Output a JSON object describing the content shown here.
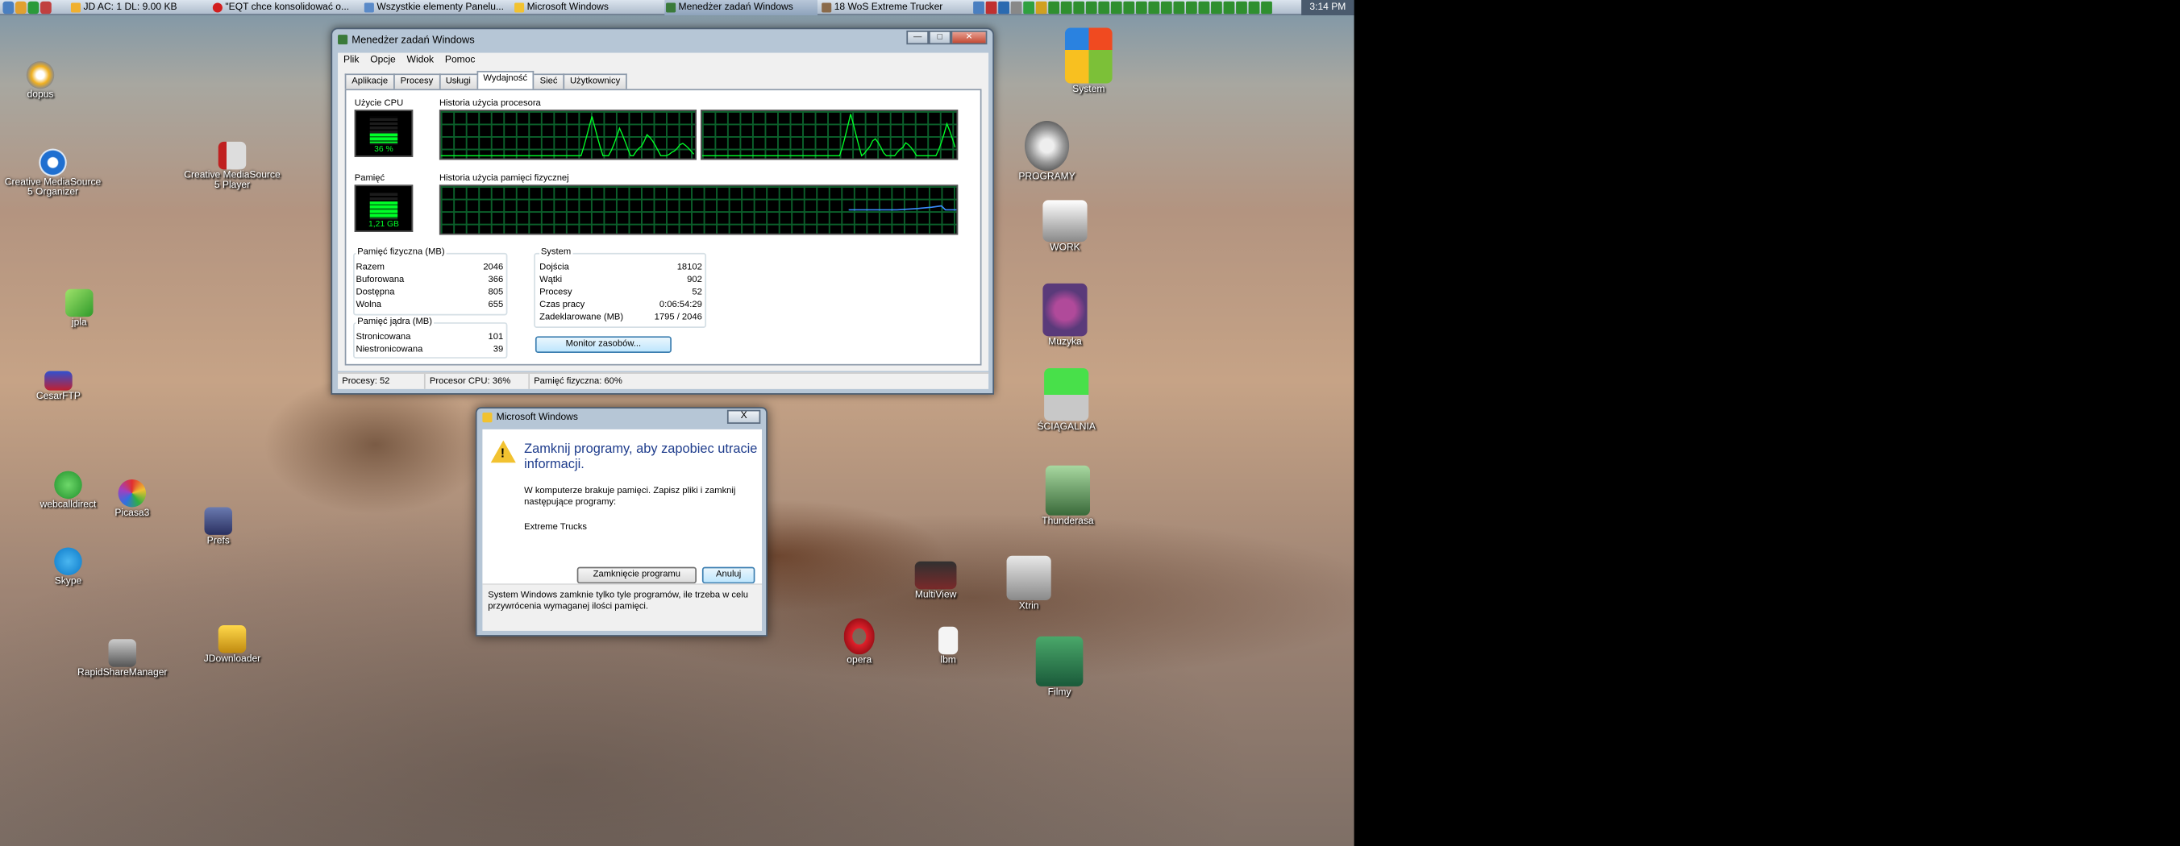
{
  "taskbar": {
    "buttons": [
      {
        "label": "JD AC: 1 DL: 9.00 KB",
        "active": false
      },
      {
        "label": "\"EQT chce konsolidować o...",
        "active": false
      },
      {
        "label": "Wszystkie elementy Panelu...",
        "active": false
      },
      {
        "label": "Microsoft Windows",
        "active": false
      },
      {
        "label": "Menedżer zadań Windows",
        "active": true
      },
      {
        "label": "18 WoS Extreme Trucker",
        "active": false
      }
    ],
    "clock": "3:14 PM"
  },
  "desktop_icons": [
    "dopus",
    "Creative MediaSource 5 Organizer",
    "Creative MediaSource 5 Player",
    "jpla",
    "CesarFTP",
    "webcalldirect",
    "Picasa3",
    "Prefs",
    "Skype",
    "RapidShareManager",
    "JDownloader",
    "System",
    "PROGRAMY",
    "WORK",
    "Muzyka",
    "ŚCIĄGALNIA",
    "Thunderasa",
    "MultiView",
    "Xtrin",
    "opera",
    "lbm",
    "Filmy"
  ],
  "task_manager": {
    "title": "Menedżer zadań Windows",
    "menu": [
      "Plik",
      "Opcje",
      "Widok",
      "Pomoc"
    ],
    "tabs": [
      "Aplikacje",
      "Procesy",
      "Usługi",
      "Wydajność",
      "Sieć",
      "Użytkownicy"
    ],
    "selected_tab": "Wydajność",
    "cpu": {
      "label": "Użycie CPU",
      "value": "36 %",
      "fraction": 0.36,
      "history_label": "Historia użycia procesora"
    },
    "memory": {
      "label": "Pamięć",
      "value": "1,21 GB",
      "fraction": 0.6,
      "history_label": "Historia użycia pamięci fizycznej"
    },
    "physical": {
      "title": "Pamięć fizyczna (MB)",
      "rows": [
        [
          "Razem",
          "2046"
        ],
        [
          "Buforowana",
          "366"
        ],
        [
          "Dostępna",
          "805"
        ],
        [
          "Wolna",
          "655"
        ]
      ]
    },
    "kernel": {
      "title": "Pamięć jądra (MB)",
      "rows": [
        [
          "Stronicowana",
          "101"
        ],
        [
          "Niestronicowana",
          "39"
        ]
      ]
    },
    "system": {
      "title": "System",
      "rows": [
        [
          "Dojścia",
          "18102"
        ],
        [
          "Wątki",
          "902"
        ],
        [
          "Procesy",
          "52"
        ],
        [
          "Czas pracy",
          "0:06:54:29"
        ],
        [
          "Zadeklarowane (MB)",
          "1795 / 2046"
        ]
      ]
    },
    "monitor_button": "Monitor zasobów...",
    "status": {
      "processes": "Procesy: 52",
      "cpu": "Procesor CPU: 36%",
      "memory": "Pamięć fizyczna: 60%"
    }
  },
  "dialog": {
    "title": "Microsoft Windows",
    "close": "X",
    "heading": "Zamknij programy, aby zapobiec utracie informacji.",
    "text": "W komputerze brakuje pamięci. Zapisz pliki i zamknij następujące programy:",
    "program": "Extreme Trucks",
    "close_program_button": "Zamknięcie programu",
    "cancel_button": "Anuluj",
    "footer": "System Windows zamknie tylko tyle programów, ile trzeba w celu przywrócenia wymaganej ilości pamięci."
  },
  "colors": {
    "graph_line": "#00ff28",
    "grid": "#0b5e2a",
    "memory_line": "#3a8cff",
    "warning": "#f2c230",
    "dialog_heading": "#1e3c8c"
  }
}
